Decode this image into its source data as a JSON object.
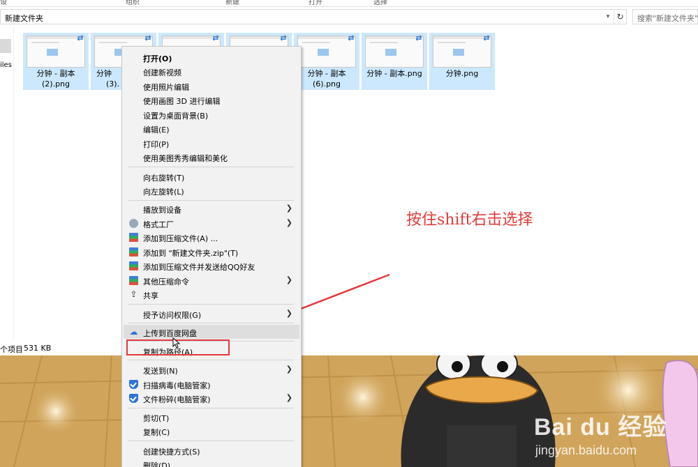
{
  "ribbon": {
    "groups": [
      "设",
      "组织",
      "新建",
      "打开",
      "选择"
    ]
  },
  "address": {
    "path": "新建文件夹",
    "search_placeholder": "搜索\"新建文件夹\""
  },
  "navpane": {
    "partial_label": "iles"
  },
  "files": [
    {
      "name": "分钟 - 副本 (2).png"
    },
    {
      "name": "分钟 - 副本 (3).png"
    },
    {
      "name": ""
    },
    {
      "name": ""
    },
    {
      "name": "分钟 - 副本 (6).png"
    },
    {
      "name": "分钟 - 副本.png"
    },
    {
      "name": "分钟.png"
    }
  ],
  "file_labels": {
    "f0a": "分钟 - 副本",
    "f0b": "(2).png",
    "f1a": "分钟",
    "f1b": "(3).",
    "f4a": "分钟 - 副本",
    "f4b": "(6).png",
    "f5a": "分钟 - 副本.png",
    "f6a": "分钟.png"
  },
  "status": {
    "items": "个项目",
    "size": "531 KB"
  },
  "context_menu": {
    "items": [
      {
        "label": "打开(O)",
        "bold": true
      },
      {
        "label": "创建新视频"
      },
      {
        "label": "使用照片编辑"
      },
      {
        "label": "使用画图 3D 进行编辑"
      },
      {
        "label": "设置为桌面背景(B)"
      },
      {
        "label": "编辑(E)"
      },
      {
        "label": "打印(P)"
      },
      {
        "label": "使用美图秀秀编辑和美化"
      },
      {
        "label": "向右旋转(T)"
      },
      {
        "label": "向左旋转(L)"
      },
      {
        "label": "播放到设备",
        "submenu": true
      },
      {
        "label": "格式工厂",
        "submenu": true,
        "icon": "format-factory-icon"
      },
      {
        "label": "添加到压缩文件(A) ...",
        "icon": "winrar-icon"
      },
      {
        "label": "添加到 \"新建文件夹.zip\"(T)",
        "icon": "winrar-icon"
      },
      {
        "label": "添加到压缩文件并发送给QQ好友",
        "icon": "winrar-icon"
      },
      {
        "label": "其他压缩命令",
        "submenu": true,
        "icon": "winrar-icon"
      },
      {
        "label": "共享",
        "icon": "share-icon"
      },
      {
        "label": "授予访问权限(G)",
        "submenu": true
      },
      {
        "label": "上传到百度网盘",
        "icon": "baidu-cloud-icon",
        "highlighted": true
      },
      {
        "label": "复制为路径(A)"
      },
      {
        "label": "发送到(N)",
        "submenu": true
      },
      {
        "label": "扫描病毒(电脑管家)",
        "icon": "shield-icon"
      },
      {
        "label": "文件粉碎(电脑管家)",
        "submenu": true,
        "icon": "shield-icon"
      },
      {
        "label": "剪切(T)"
      },
      {
        "label": "复制(C)"
      },
      {
        "label": "创建快捷方式(S)"
      },
      {
        "label": "删除(D)"
      }
    ]
  },
  "annotation": {
    "text": "按住shift右击选择",
    "color": "#e23a3a"
  },
  "watermark": {
    "brand": "Bai du 经验",
    "url": "jingyan.baidu.com"
  },
  "colors": {
    "selection": "#cce8ff",
    "menu_bg": "#f2f2f2",
    "highlight": "#dedede",
    "annotation_red": "#e4393c"
  }
}
